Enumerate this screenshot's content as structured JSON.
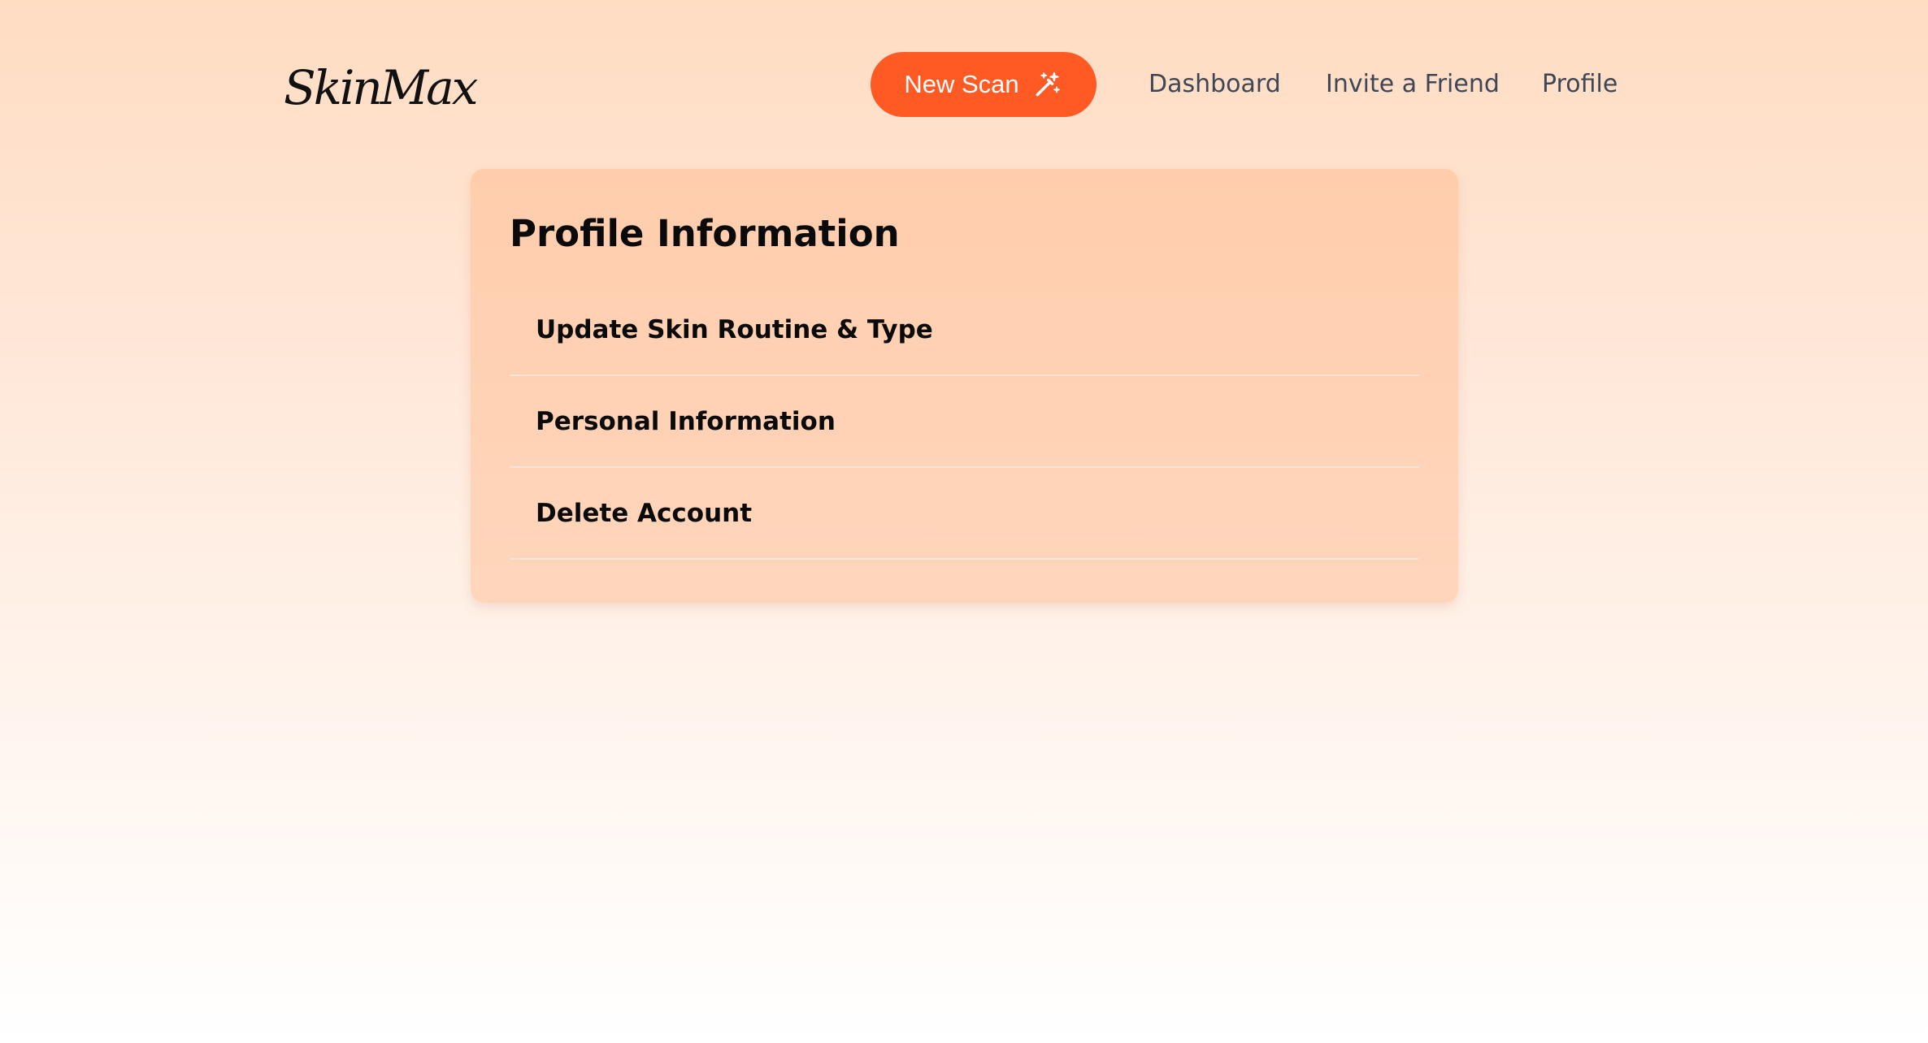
{
  "header": {
    "logo_text": "SkinMax",
    "new_scan_label": "New Scan",
    "new_scan_icon": "magic-wand-sparkles-icon",
    "nav_links": [
      "Dashboard",
      "Invite a Friend",
      "Profile"
    ]
  },
  "card": {
    "title": "Profile Information",
    "items": [
      {
        "label": "Update Skin Routine & Type"
      },
      {
        "label": "Personal Information"
      },
      {
        "label": "Delete Account"
      }
    ]
  },
  "colors": {
    "accent": "#ff5a24",
    "card_background": "#ffd0b0",
    "nav_text": "#3f4654"
  }
}
